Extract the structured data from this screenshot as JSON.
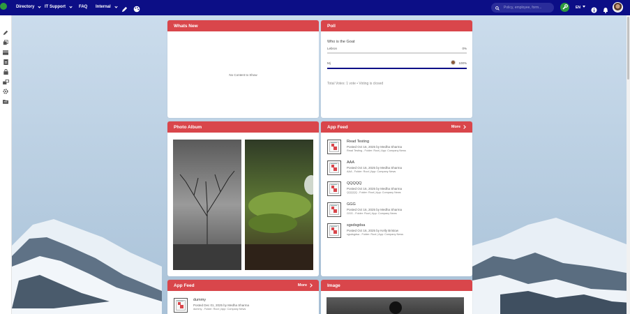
{
  "topbar": {
    "nav": [
      {
        "label": "Directory"
      },
      {
        "label": "IT Support"
      },
      {
        "label": "FAQ"
      },
      {
        "label": "Internal"
      }
    ],
    "search_placeholder": "Policy, employee, form...",
    "language": "EN",
    "icons": [
      "pencil-icon",
      "palette-icon",
      "search-icon",
      "wrench-icon",
      "info-icon",
      "bell-icon",
      "user-avatar"
    ]
  },
  "sidebar": {
    "items": [
      "edit-icon",
      "layers-icon",
      "card-icon",
      "document-icon",
      "lock-icon",
      "users-icon",
      "settings-icon",
      "folder-icon"
    ]
  },
  "whats_new": {
    "title": "Whats New",
    "empty_text": "No Content to Show"
  },
  "poll": {
    "title": "Poll",
    "question": "Who is the Goat",
    "options": [
      {
        "label": "Lebron",
        "percent": "0%",
        "fill": 0
      },
      {
        "label": "Mj",
        "percent": "100%",
        "fill": 1
      }
    ],
    "total_votes": "Total Votes: 1 vote",
    "status": "Voting is closed"
  },
  "photo_album": {
    "title": "Photo Album"
  },
  "app_feed": {
    "title": "App Feed",
    "more": "More",
    "items": [
      {
        "title": "Read Testing",
        "meta": "Posted Oct 16, 2025 by Medha Sharma",
        "sub": "Read Testing - Folder: Root | App: Company News"
      },
      {
        "title": "AAA",
        "meta": "Posted Oct 16, 2025 by Medha Sharma",
        "sub": "AAA - Folder: Root | App: Company News"
      },
      {
        "title": "QQQQQ",
        "meta": "Posted Oct 16, 2025 by Medha Sharma",
        "sub": "QQQQQ - Folder: Root | App: Company News"
      },
      {
        "title": "GGG",
        "meta": "Posted Oct 16, 2025 by Medha Sharma",
        "sub": "GGG - Folder: Root | App: Company News"
      },
      {
        "title": "sgsdsgdsa",
        "meta": "Posted Oct 16, 2025 by Kelly Bristow",
        "sub": "sgsdsgdsa - Folder: Root | App: Company News"
      }
    ]
  },
  "app_feed_2": {
    "title": "App Feed",
    "more": "More",
    "items": [
      {
        "title": "dummy",
        "meta": "Posted Dec 01, 2025 by Medha Sharma",
        "sub": "dummy - Folder: Root | App: Company News"
      }
    ]
  },
  "image_card": {
    "title": "Image"
  },
  "colors": {
    "topbar": "#0c0e86",
    "card_header": "#d9464b",
    "accent_green": "#2e9a3e"
  }
}
